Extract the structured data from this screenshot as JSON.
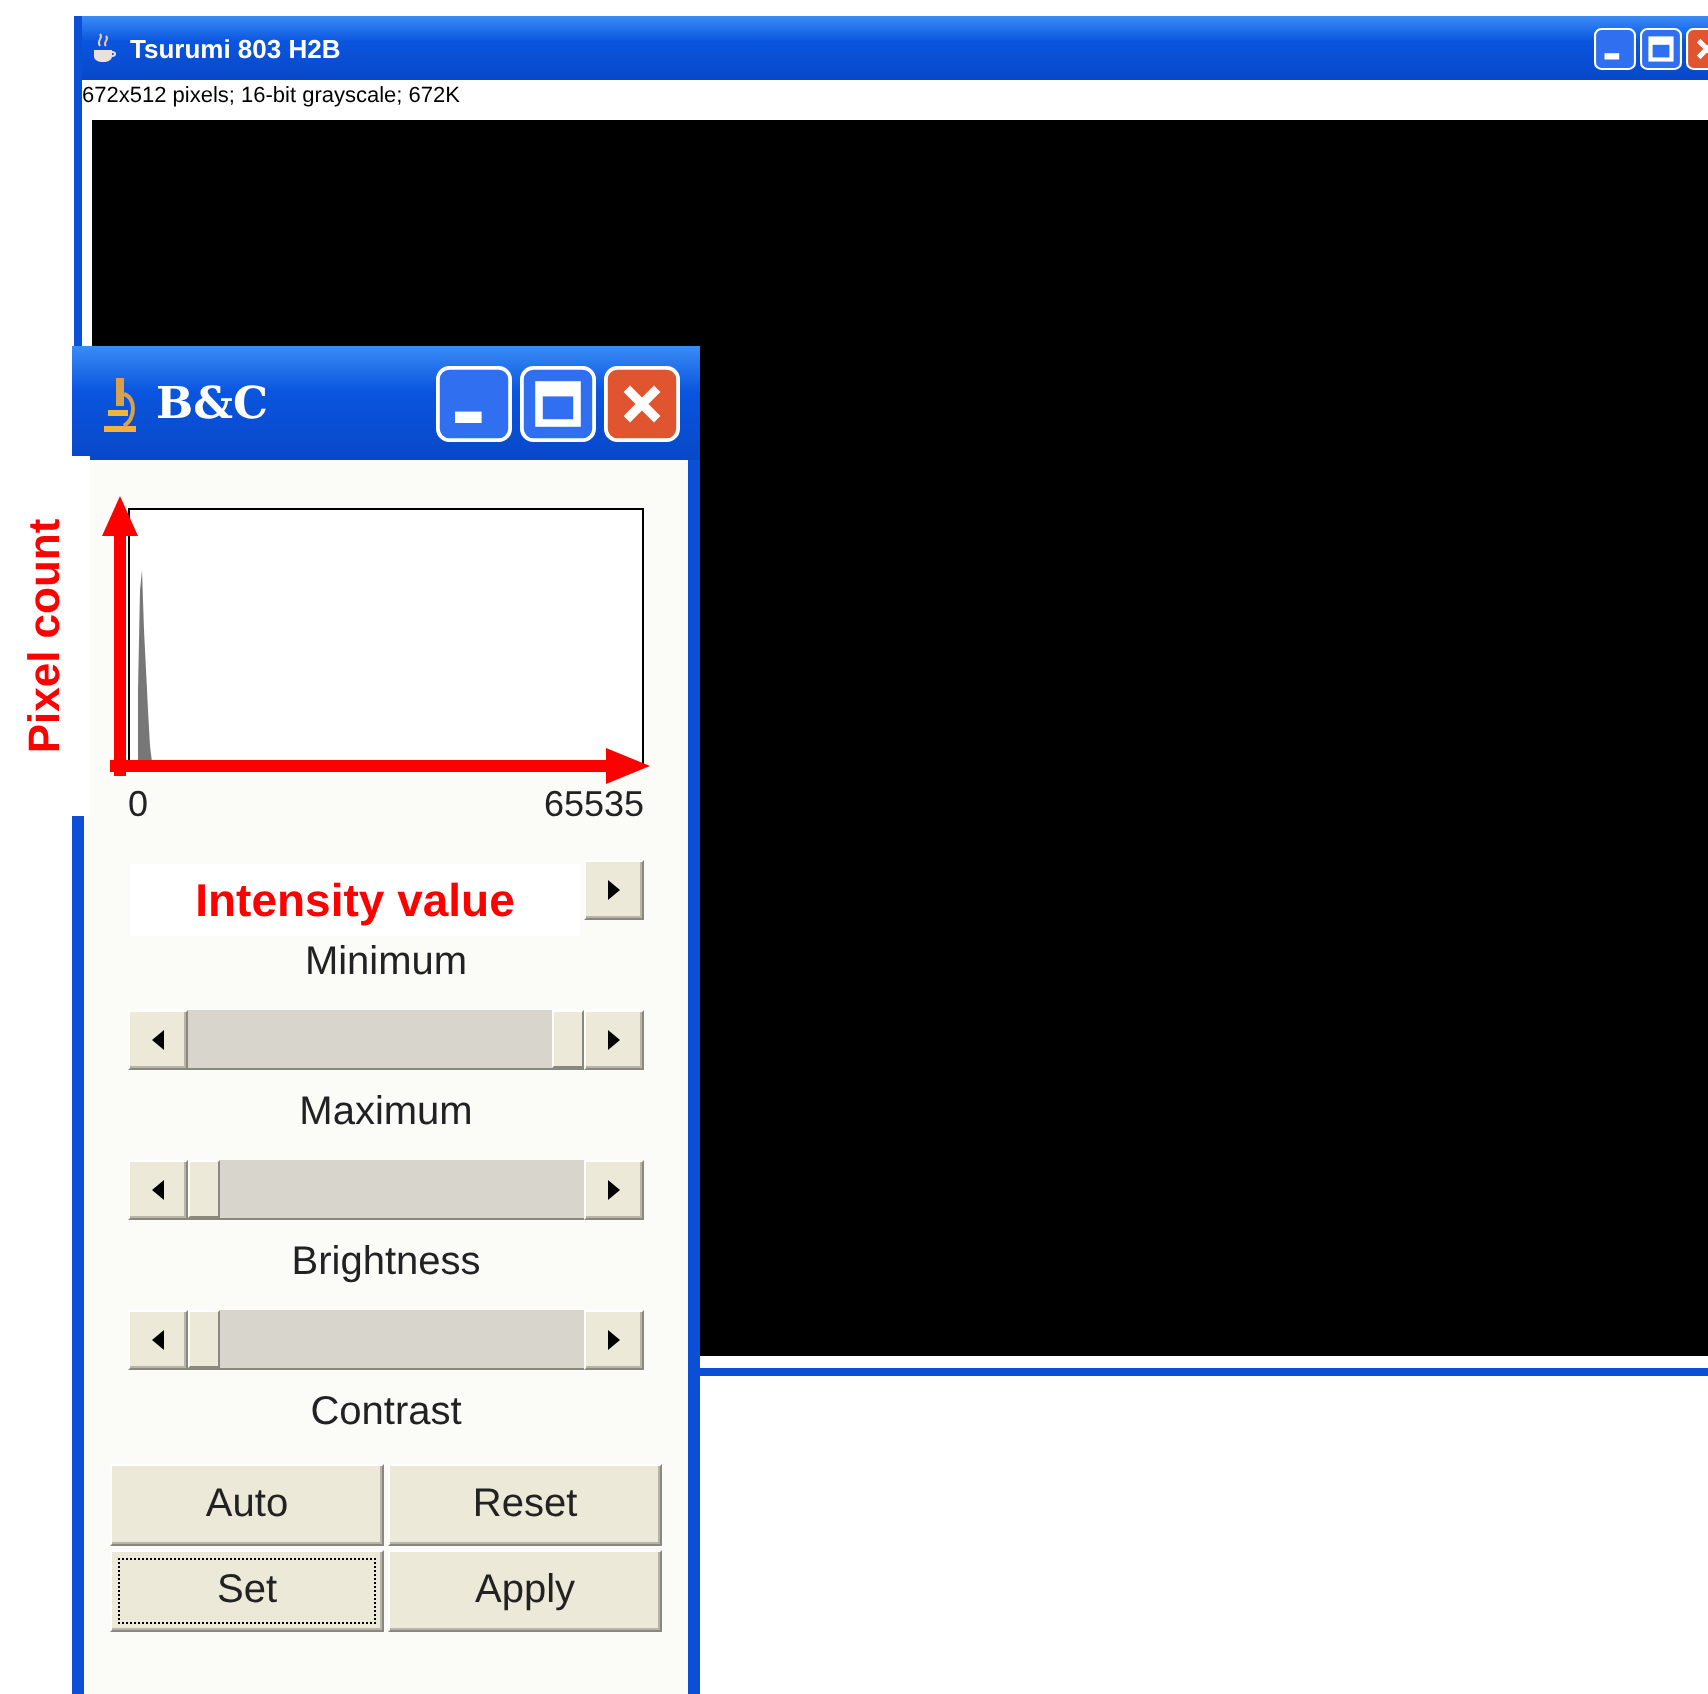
{
  "image_window": {
    "title": "Tsurumi 803 H2B",
    "info": "672x512 pixels; 16-bit grayscale; 672K"
  },
  "bc_window": {
    "title": "B&C",
    "histogram": {
      "range_min": "0",
      "range_max": "65535"
    },
    "sliders": [
      {
        "label": "Minimum"
      },
      {
        "label": "Maximum",
        "level": 1
      },
      {
        "label": "Brightness",
        "level": 0
      },
      {
        "label": "Contrast",
        "level": 0
      }
    ],
    "buttons": [
      {
        "label": "Auto",
        "focused": false
      },
      {
        "label": "Reset",
        "focused": false
      },
      {
        "label": "Set",
        "focused": true
      },
      {
        "label": "Apply",
        "focused": false
      }
    ]
  },
  "annotations": [
    {
      "kind": "vertical",
      "text": "Pixel count"
    },
    {
      "kind": "horizontal",
      "text": "Intensity value"
    }
  ]
}
